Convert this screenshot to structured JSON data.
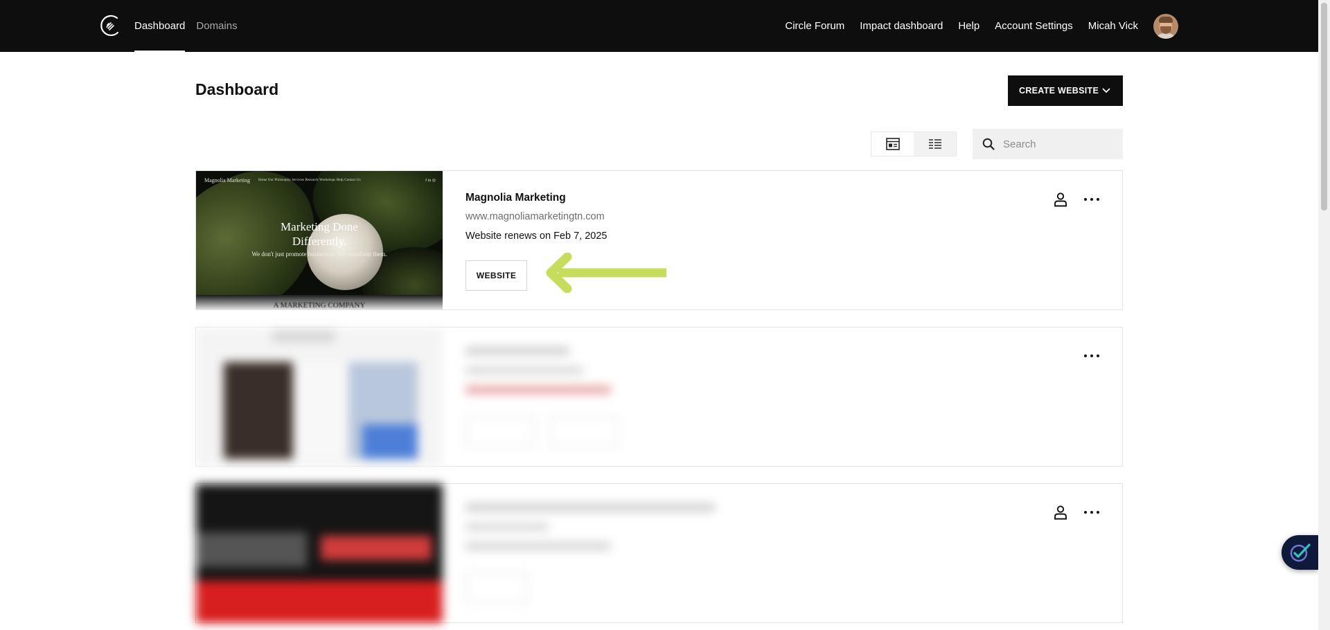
{
  "nav": {
    "left": [
      "Dashboard",
      "Domains"
    ],
    "right": [
      "Circle Forum",
      "Impact dashboard",
      "Help",
      "Account Settings"
    ],
    "user_name": "Micah Vick"
  },
  "page": {
    "title": "Dashboard",
    "create_button": "CREATE WEBSITE",
    "search_placeholder": "Search",
    "active_view": "grid"
  },
  "sites": [
    {
      "name": "Magnolia Marketing",
      "url": "www.magnoliamarketingtn.com",
      "renewal": "Website renews on Feb 7, 2025",
      "button": "WEBSITE",
      "thumbnail": {
        "brand": "Magnolia Marketing",
        "nav_links": "Home   Our Philosophy   Services   Research Workshops   Help   Contact Us",
        "socials": "f  in  ◎",
        "headline_line1": "Marketing Done",
        "headline_line2": "Differently.",
        "subline": "We don't just promote businesses. We transform them.",
        "footer_text": "A MARKETING COMPANY"
      }
    }
  ],
  "colors": {
    "header_bg": "#0e0e0e",
    "arrow": "#c6dc5c",
    "widget_bg": "#0f1a3b"
  },
  "icons": {
    "logo": "squarespace-logo-icon",
    "grid_view": "grid-view-icon",
    "list_view": "list-view-icon",
    "search": "search-icon",
    "person": "person-icon",
    "more": "more-icon",
    "widget": "check-circle-icon"
  }
}
